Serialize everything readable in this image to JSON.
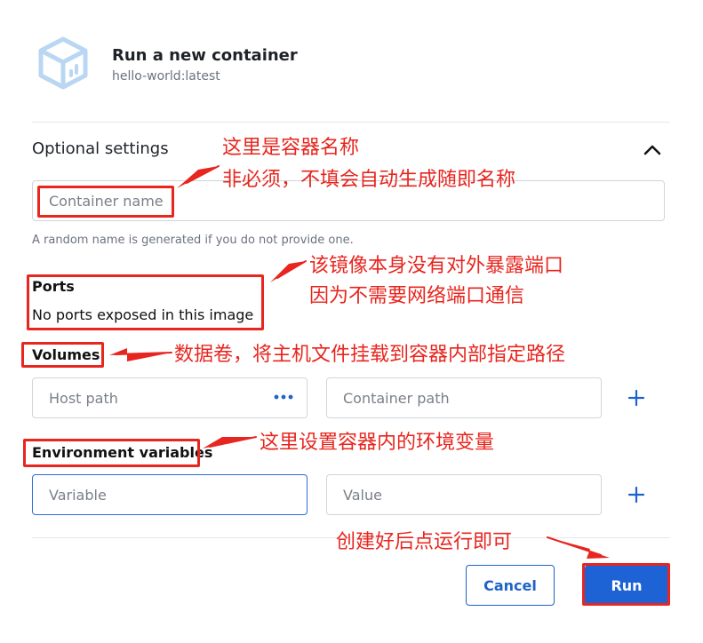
{
  "header": {
    "title": "Run a new container",
    "subtitle": "hello-world:latest",
    "logo_icon": "container-box-icon"
  },
  "optional_settings": {
    "title": "Optional settings",
    "toggle_icon": "chevron-up-icon",
    "container_name": {
      "placeholder": "Container name",
      "value": ""
    },
    "help_text": "A random name is generated if you do not provide one."
  },
  "ports": {
    "label": "Ports",
    "text": "No ports exposed in this image"
  },
  "volumes": {
    "label": "Volumes",
    "host_path": {
      "placeholder": "Host path",
      "value": ""
    },
    "container_path": {
      "placeholder": "Container path",
      "value": ""
    },
    "more_icon": "ellipsis-icon",
    "add_icon": "plus-icon"
  },
  "env": {
    "label": "Environment variables",
    "variable": {
      "placeholder": "Variable",
      "value": ""
    },
    "value": {
      "placeholder": "Value",
      "value": ""
    },
    "add_icon": "plus-icon"
  },
  "actions": {
    "cancel_label": "Cancel",
    "run_label": "Run"
  },
  "annotations": {
    "name_line1": "这里是容器名称",
    "name_line2": "非必须，不填会自动生成随即名称",
    "ports_line1": "该镜像本身没有对外暴露端口",
    "ports_line2": "因为不需要网络端口通信",
    "volumes": "数据卷，将主机文件挂载到容器内部指定路径",
    "env": "这里设置容器内的环境变量",
    "run": "创建好后点运行即可"
  },
  "colors": {
    "accent": "#1d63d6",
    "annotation": "#e8251e",
    "logo": "#b9d7f3"
  }
}
